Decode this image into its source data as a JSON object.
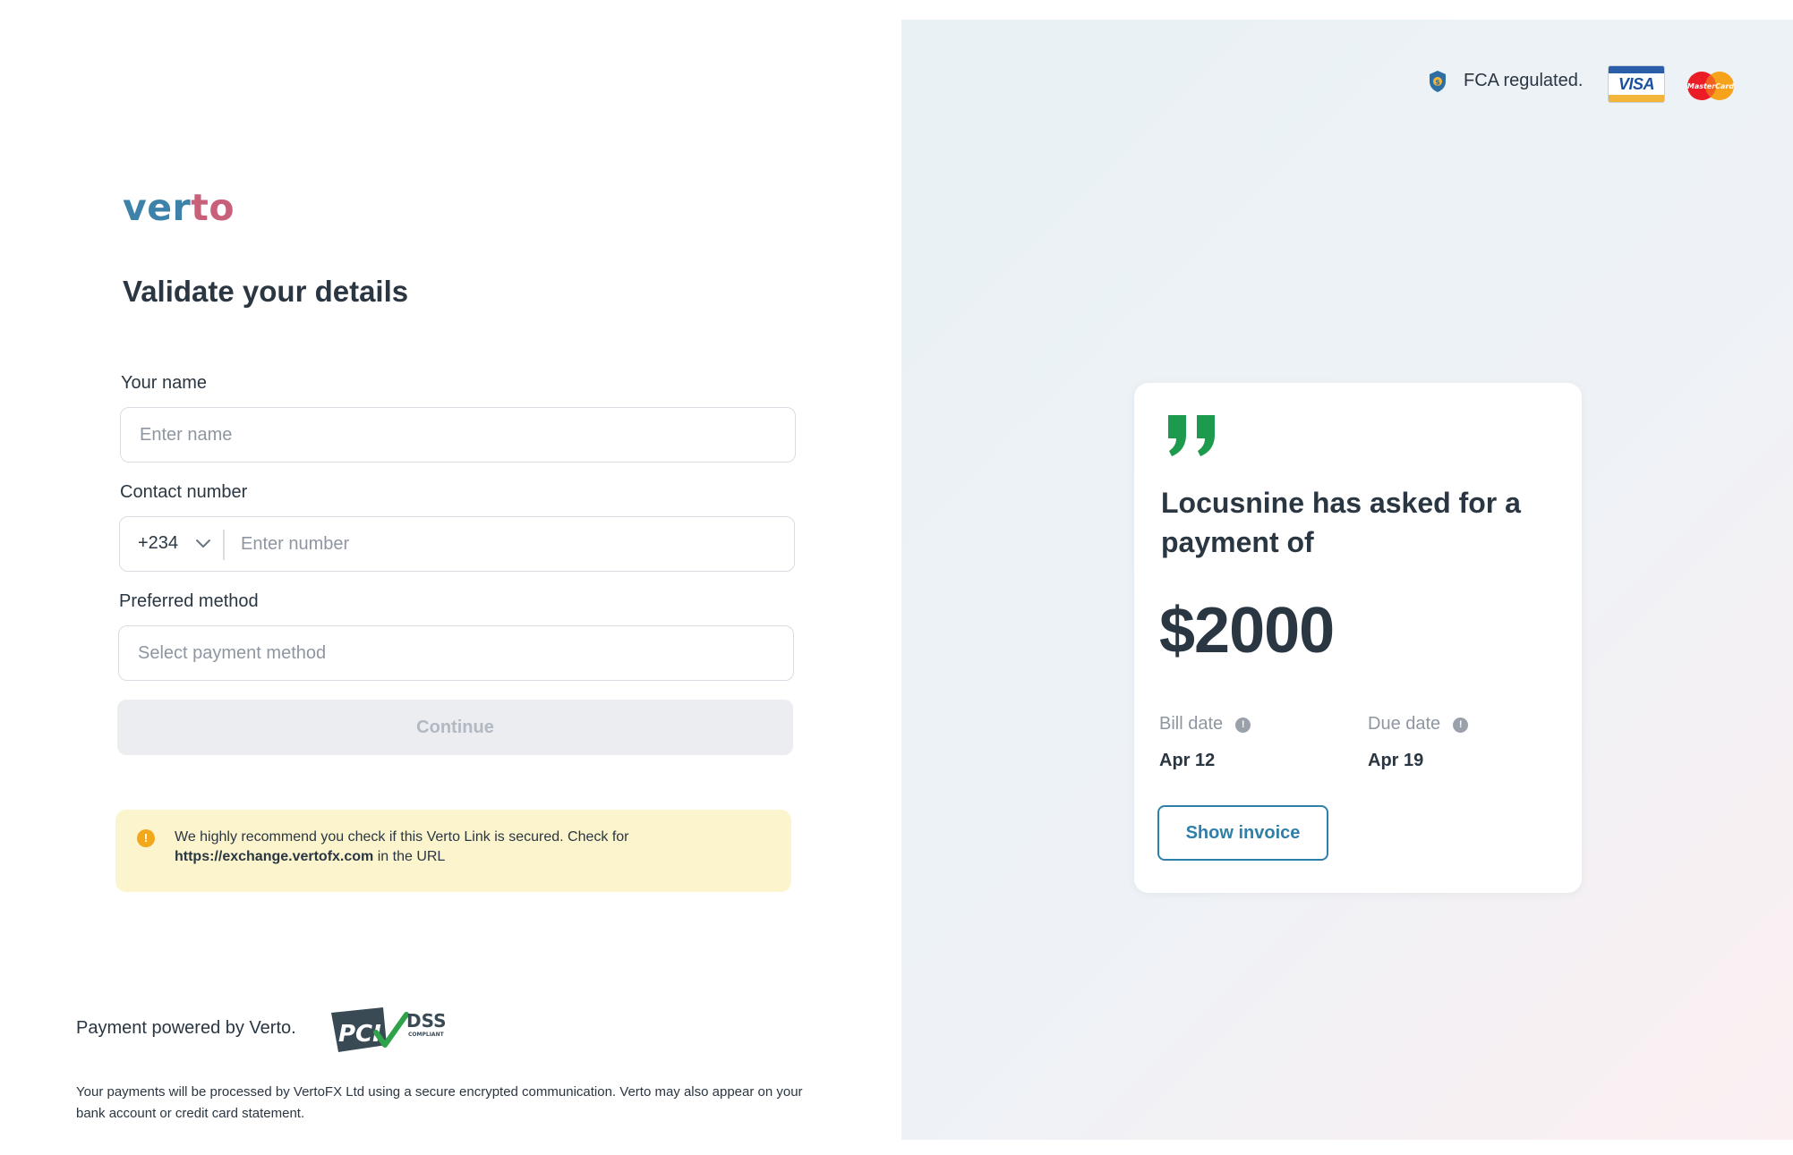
{
  "brand": {
    "logo_part1": "ver",
    "logo_part2": "to"
  },
  "form": {
    "title": "Validate your details",
    "name": {
      "label": "Your name",
      "placeholder": "Enter name"
    },
    "contact": {
      "label": "Contact number",
      "country_code": "+234",
      "placeholder": "Enter number"
    },
    "method": {
      "label": "Preferred method",
      "placeholder": "Select payment method"
    },
    "continue_label": "Continue"
  },
  "warning": {
    "text_before": "We highly recommend you check if this Verto Link is secured. Check for",
    "url": "https://exchange.vertofx.com",
    "text_after": "in the URL"
  },
  "footer": {
    "powered": "Payment powered by Verto.",
    "pci_text": "PCI",
    "dss_text": "DSS",
    "compliant_text": "COMPLIANT",
    "disclaimer": "Your payments will be processed by VertoFX Ltd using a secure encrypted communication. Verto may also appear on your bank account or credit card statement."
  },
  "trust": {
    "fca": "FCA regulated.",
    "visa": "VISA",
    "mastercard": "MasterCard"
  },
  "request": {
    "message": "Locusnine has asked for a payment of",
    "amount": "$2000",
    "bill_date_label": "Bill date",
    "bill_date": "Apr 12",
    "due_date_label": "Due date",
    "due_date": "Apr 19",
    "invoice_button": "Show invoice"
  },
  "colors": {
    "accent": "#2e7fa9",
    "logo_blue": "#3f82a9",
    "logo_pink": "#c9607a",
    "quote_green": "#1e9a4e",
    "warning_bg": "#fbf4cd",
    "warning_icon": "#f3a81c"
  }
}
